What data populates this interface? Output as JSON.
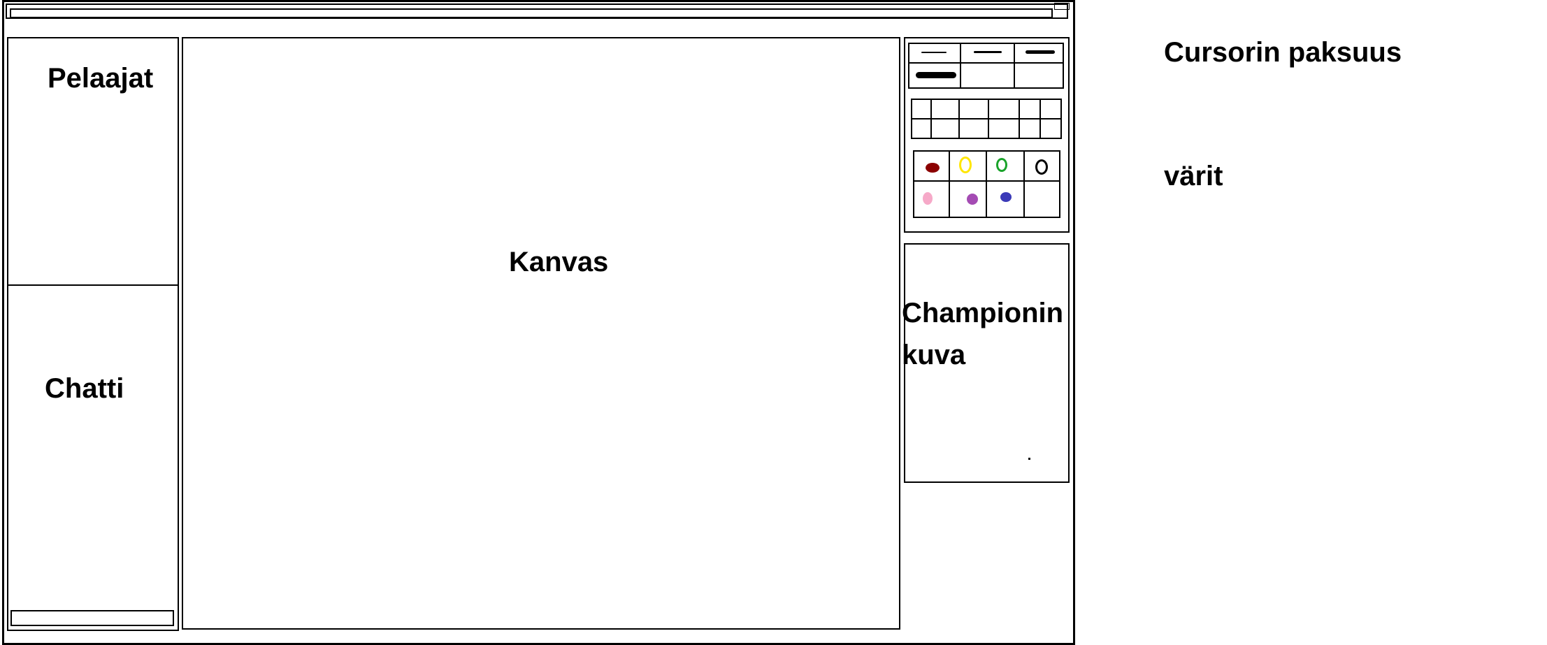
{
  "left_panel": {
    "players_label": "Pelaajat",
    "chat_label": "Chatti"
  },
  "canvas": {
    "label": "Kanvas"
  },
  "champion": {
    "label": "Championin kuva"
  },
  "annotations": {
    "cursor_thickness": "Cursorin paksuus",
    "colors": "värit"
  },
  "palette": {
    "colors": [
      "#8b0000",
      "#ffe600",
      "#1aa32a",
      "#000000",
      "#f6a9c8",
      "#a44bb3",
      "#3b3ab8",
      ""
    ]
  }
}
